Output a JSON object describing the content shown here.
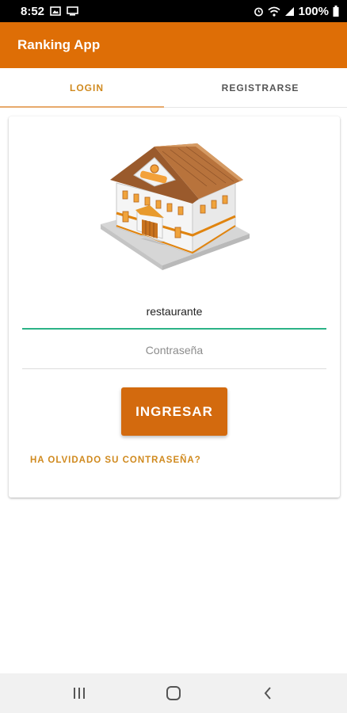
{
  "status_bar": {
    "time": "8:52",
    "battery": "100%",
    "left_icons": [
      "image-icon",
      "cast-icon"
    ],
    "right_icons": [
      "alarm-icon",
      "wifi-icon",
      "signal-icon",
      "battery-icon"
    ]
  },
  "app_bar": {
    "title": "Ranking App"
  },
  "tabs": [
    {
      "label": "LOGIN",
      "selected": true
    },
    {
      "label": "REGISTRARSE",
      "selected": false
    }
  ],
  "form": {
    "username_value": "restaurante",
    "password_placeholder": "Contraseña",
    "submit_label": "INGRESAR",
    "forgot_label": "HA OLVIDADO SU CONTRASEÑA?"
  },
  "colors": {
    "primary": "#de6e06",
    "accent": "#d08a1f",
    "focus_underline": "#2bb386",
    "button": "#d36a0e"
  },
  "nav_bar": {
    "buttons": [
      "recent-apps-icon",
      "home-icon",
      "back-icon"
    ]
  }
}
